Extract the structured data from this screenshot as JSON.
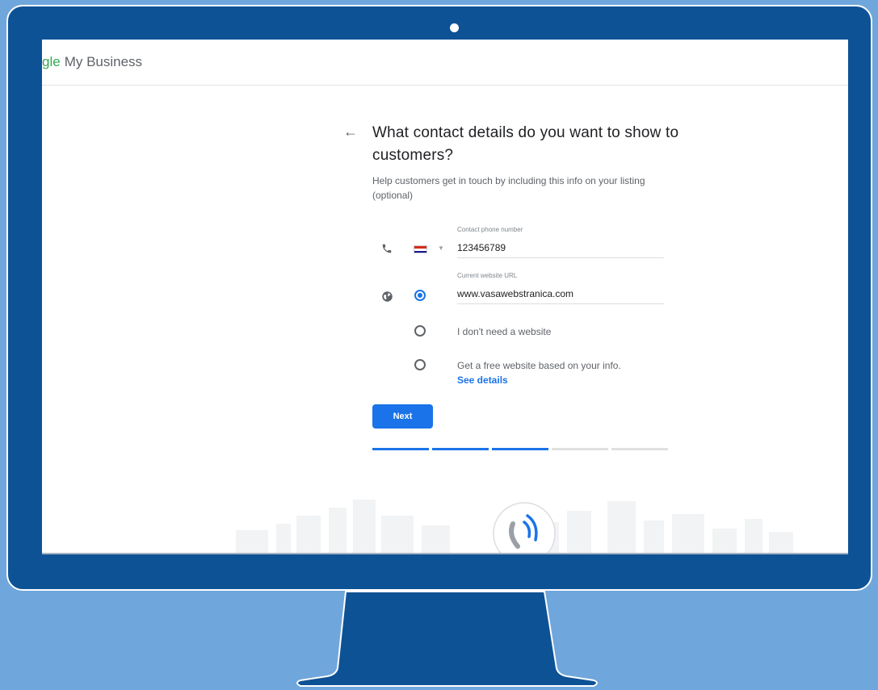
{
  "colors": {
    "background": "#6fa6dc",
    "monitor": "#0e5296",
    "accent": "#1a73e8",
    "progress_track": "#e0e0e0"
  },
  "app": {
    "brand_partial": "gle",
    "brand_name": "My Business"
  },
  "page": {
    "back_icon": "arrow-left-icon",
    "title": "What contact details do you want to show to customers?",
    "subtitle": "Help customers get in touch by including this info on your listing (optional)"
  },
  "phone": {
    "icon": "phone-icon",
    "country_flag": "croatia-flag-icon",
    "label": "Contact phone number",
    "value": "123456789"
  },
  "website": {
    "icon": "globe-icon",
    "label": "Current website URL",
    "value": "www.vasawebstranica.com",
    "options": [
      {
        "label": "",
        "selected": true
      },
      {
        "label": "I don't need a website",
        "selected": false
      },
      {
        "label": "Get a free website based on your info.",
        "link": "See details",
        "selected": false
      }
    ]
  },
  "actions": {
    "next_label": "Next"
  },
  "progress": {
    "total_steps": 5,
    "completed_steps": 3
  }
}
